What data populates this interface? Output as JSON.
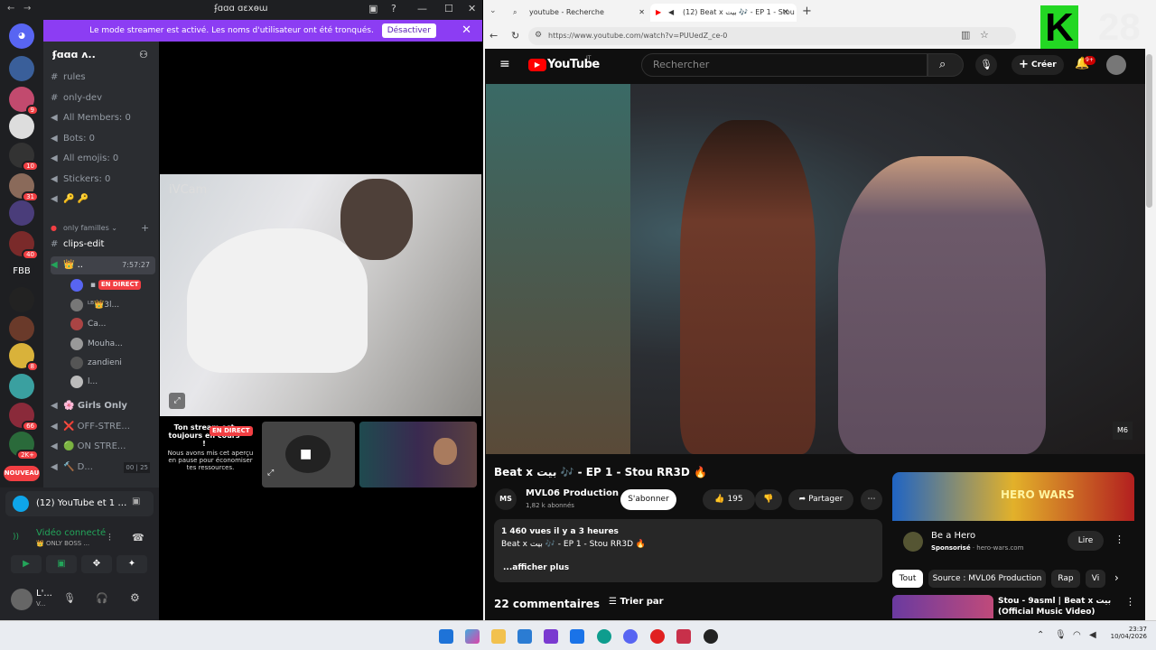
{
  "discord": {
    "title": "ʄɑɑɑ ɑɛxɵɯ",
    "banner": {
      "text": "Le mode streamer est activé. Les noms d'utilisateur ont été tronqués.",
      "button": "Désactiver"
    },
    "server_name": "ʄɑɑɑ ʌ..",
    "server_badges": [
      "9",
      "10",
      "31",
      "40",
      "8",
      "66",
      "2K+"
    ],
    "fbb_label": "FBB",
    "nouveau": "NOUVEAU",
    "channels": [
      {
        "icon": "#",
        "label": "rules"
      },
      {
        "icon": "#",
        "label": "only-dev"
      },
      {
        "icon": "🔊",
        "label": "All Members: 0"
      },
      {
        "icon": "🔊",
        "label": "Bots: 0"
      },
      {
        "icon": "🔊",
        "label": "All emojis: 0"
      },
      {
        "icon": "🔊",
        "label": "Stickers: 0"
      },
      {
        "icon": "🔊",
        "label": "🔑 🔑"
      }
    ],
    "category": "only familles",
    "clips": "clips-edit",
    "active_voice": {
      "label": "👑 ..",
      "time": "7:57:27"
    },
    "voice_users": [
      {
        "name": "",
        "live": "EN DIRECT"
      },
      {
        "name": "ᴸᴮ👑3l...",
        "live": ""
      },
      {
        "name": "Ca...",
        "live": ""
      },
      {
        "name": "Mouha...",
        "live": ""
      },
      {
        "name": "zandieni",
        "live": ""
      },
      {
        "name": "l...",
        "live": ""
      }
    ],
    "voice_channels": [
      {
        "label": "🌸 Girls Only",
        "extra": ""
      },
      {
        "label": "❌ OFF-STRE...",
        "extra": ""
      },
      {
        "label": "🟢 ON STRE...",
        "extra": ""
      },
      {
        "label": "🔨 D...",
        "extra": "00 | 25"
      }
    ],
    "activity": "(12) YouTube et 1 pa...",
    "voice_connected": "Vidéo connecté",
    "voice_channel_name": "👑 ONLY BOSS ...",
    "user": {
      "name": "L'...",
      "status": "V..."
    },
    "stream": {
      "icam": "iVCam",
      "paused_title": "Ton stream est toujours en cours !",
      "paused_badge": "EN DIRECT",
      "paused_text": "Nous avons mis cet aperçu en pause pour économiser tes ressources."
    }
  },
  "chrome": {
    "tabs": [
      {
        "label": "youtube - Recherche"
      },
      {
        "label": "(12) Beat x بيت 🎶 - EP 1 - Stou"
      }
    ],
    "url": "https://www.youtube.com/watch?v=PUUedZ_ce-0"
  },
  "youtube": {
    "logo": "YouTube",
    "country": "IT",
    "search_placeholder": "Rechercher",
    "create": "Créer",
    "notif": "9+",
    "video_title": "Beat x بيت 🎶 - EP 1 - Stou RR3D 🔥",
    "channel": "MVL06 Production",
    "subs": "1,82 k abonnés",
    "subscribe": "S'abonner",
    "likes": "195",
    "share": "Partager",
    "desc_stats": "1 460 vues  il y a 3 heures",
    "desc_line": "Beat x بيت 🎶 - EP 1 - Stou RR3D 🔥",
    "desc_more": "...afficher plus",
    "comments": "22 commentaires",
    "sort": "Trier par",
    "ad": {
      "title": "Be a Hero",
      "sponsor": "Sponsorisé",
      "domain": "hero-wars.com",
      "button": "Lire",
      "brand": "HERO WARS"
    },
    "chips": [
      "Tout",
      "Source : MVL06 Production",
      "Rap",
      "Vi"
    ],
    "next_video": "Stou - 9asml | Beat x بيت (Official Music Video)",
    "watermark": "M6"
  },
  "overlay_number": "28",
  "overlay_letter": "K",
  "clock": {
    "time": "23:37",
    "date": "10/04/2026"
  }
}
